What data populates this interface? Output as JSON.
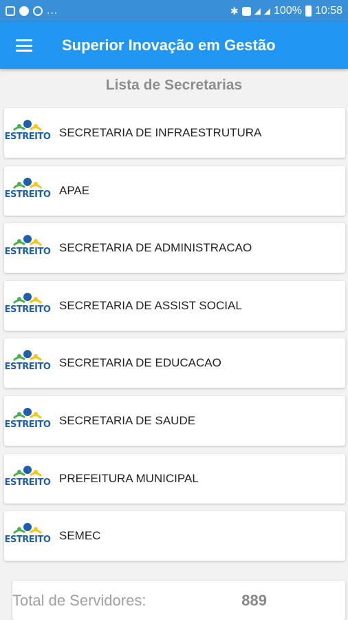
{
  "status_bar": {
    "left_icons": [
      "image-icon",
      "message-icon",
      "whatsapp-icon"
    ],
    "more": "...",
    "battery": "100%",
    "time": "10:58"
  },
  "app_bar": {
    "title": "Superior Inovação em Gestão",
    "menu_icon": "menu-icon"
  },
  "section_title": "Lista de Secretarias",
  "logo_text": "ESTREITO",
  "secretarias": [
    "SECRETARIA DE INFRAESTRUTURA",
    "APAE",
    "SECRETARIA DE ADMINISTRACAO",
    "SECRETARIA DE ASSIST SOCIAL",
    "SECRETARIA DE EDUCACAO",
    "SECRETARIA DE SAUDE",
    "PREFEITURA MUNICIPAL",
    "SEMEC"
  ],
  "footer": {
    "label": "Total de Servidores:",
    "value": "889"
  },
  "colors": {
    "primary": "#2196f3",
    "status_bar": "#3a8fd9",
    "logo_blue": "#1f5fa8",
    "logo_green": "#4caf50",
    "logo_yellow": "#f5c518"
  }
}
